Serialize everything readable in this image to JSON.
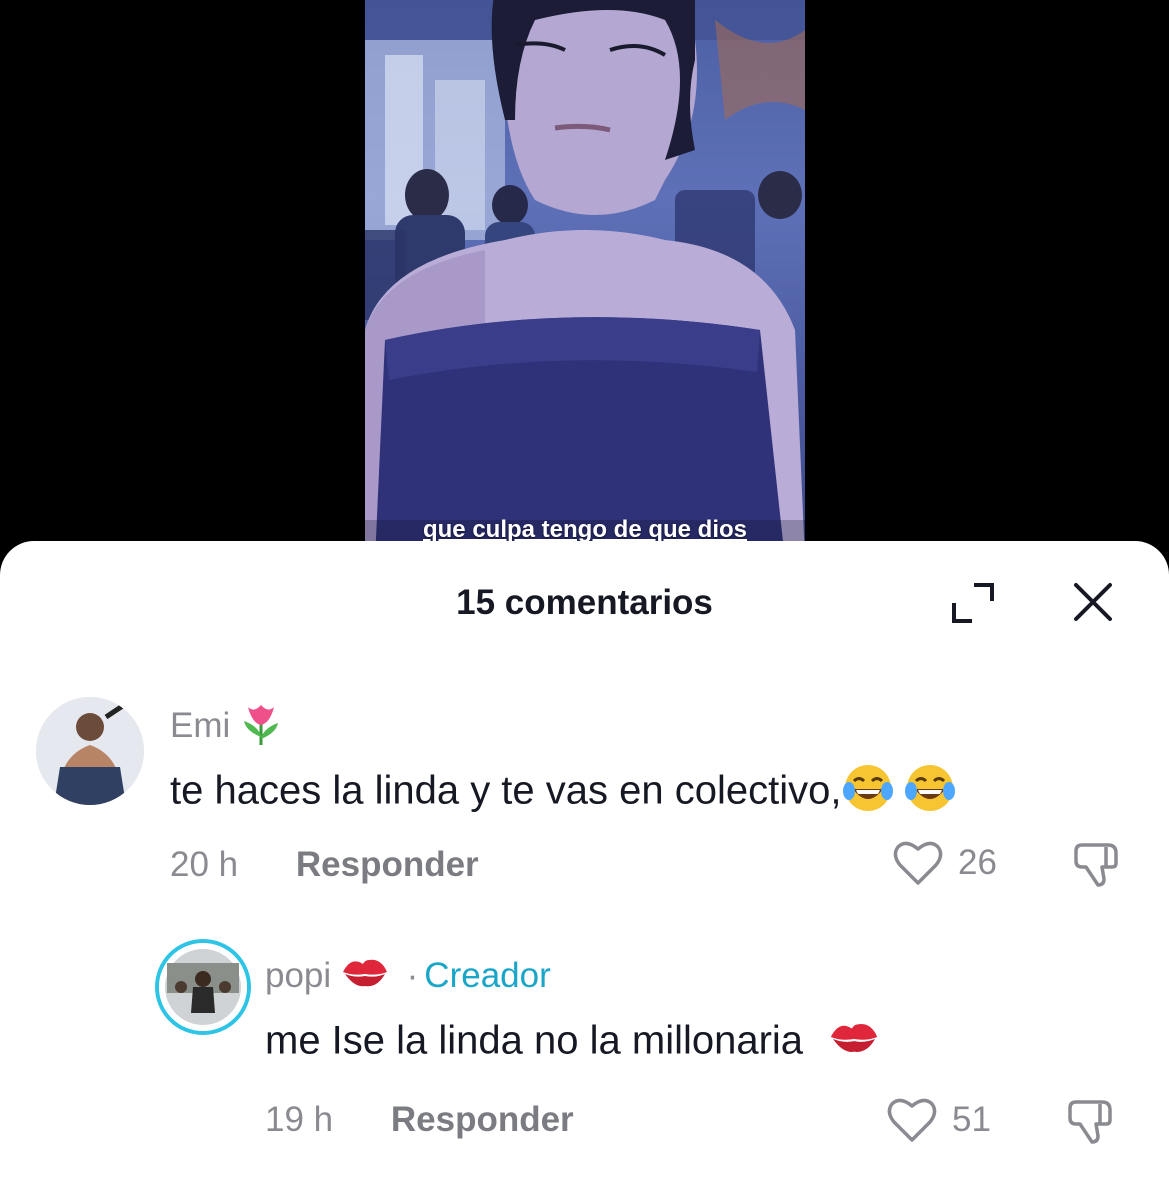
{
  "video": {
    "caption": "que culpa tengo de que dios"
  },
  "sheet": {
    "title": "15 comentarios",
    "expand_icon": "expand-icon",
    "close_icon": "close-icon"
  },
  "comments": [
    {
      "username": "Emi",
      "username_emoji": "tulip",
      "text": "te haces la linda y te vas en colectivo,",
      "text_emojis": [
        "face-with-tears-of-joy",
        "face-with-tears-of-joy"
      ],
      "time": "20 h",
      "reply_label": "Responder",
      "likes": "26"
    },
    {
      "username": "popi",
      "username_emoji": "kiss-mark",
      "badge_separator": "·",
      "badge": "Creador",
      "text": "me Ise la linda no la millonaria",
      "text_emojis": [
        "kiss-mark"
      ],
      "time": "19 h",
      "reply_label": "Responder",
      "likes": "51"
    }
  ],
  "colors": {
    "creator_badge": "#1aa6c9",
    "creator_ring": "#2ec4e6",
    "text_primary": "#161823",
    "text_secondary": "#8a8b91"
  }
}
